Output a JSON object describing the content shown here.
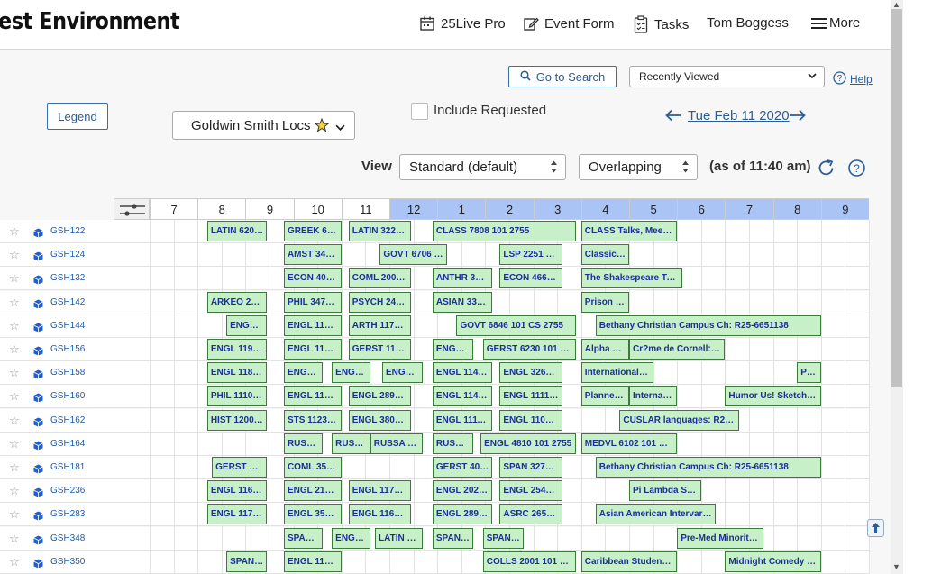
{
  "header": {
    "app_title": "est Environment",
    "nav": [
      {
        "label": "25Live Pro",
        "icon": "calendar-icon"
      },
      {
        "label": "Event Form",
        "icon": "edit-icon"
      },
      {
        "label": "Tasks",
        "icon": "clipboard-icon"
      },
      {
        "label": "Tom Boggess",
        "icon": ""
      },
      {
        "label": "More",
        "icon": "hamburger-icon"
      }
    ]
  },
  "toolbar": {
    "go_to_search": "Go to Search",
    "recently_viewed": "Recently Viewed",
    "help": "Help",
    "legend": "Legend",
    "locations_set": "Goldwin Smith Locs",
    "include_requested": "Include Requested",
    "date": "Tue Feb 11 2020",
    "view_label": "View",
    "view_value": "Standard (default)",
    "overlap_value": "Overlapping",
    "as_of": "(as of 11:40 am)"
  },
  "hours": [
    "7",
    "8",
    "9",
    "10",
    "11",
    "12",
    "1",
    "2",
    "3",
    "4",
    "5",
    "6",
    "7",
    "8",
    "9"
  ],
  "colors": {
    "accent": "#2a5d94",
    "pm_header": "#a9c4f5",
    "event_fill": "#c8f0c8",
    "event_border": "#3b7a3b",
    "event_text": "#1b2f9a"
  },
  "rooms": [
    {
      "name": "GSH122",
      "events": [
        {
          "label": "LATIN 6202 ...",
          "start": 8.2,
          "end": 9.45
        },
        {
          "label": "GREEK 6102...",
          "start": 9.8,
          "end": 11.0
        },
        {
          "label": "LATIN 3220 ...",
          "start": 11.15,
          "end": 12.45
        },
        {
          "label": "CLASS 7808 101 2755",
          "start": 12.9,
          "end": 15.9
        },
        {
          "label": "CLASS Talks, Meetings, Read: R2...",
          "start": 16.0,
          "end": 18.0
        }
      ]
    },
    {
      "name": "GSH124",
      "events": [
        {
          "label": "AMST 3434 ...",
          "start": 9.8,
          "end": 11.0
        },
        {
          "label": "GOVT 6706 101 CS 2...",
          "start": 11.8,
          "end": 13.2
        },
        {
          "label": "LSP 2251 10...",
          "start": 14.3,
          "end": 15.6
        },
        {
          "label": "Classics ...",
          "start": 16.0,
          "end": 17.0
        }
      ]
    },
    {
      "name": "GSH132",
      "events": [
        {
          "label": "ECON 4020 ...",
          "start": 9.8,
          "end": 11.0
        },
        {
          "label": "COML 2000 ...",
          "start": 11.15,
          "end": 12.45
        },
        {
          "label": "ANTHR 306...",
          "start": 12.9,
          "end": 14.15
        },
        {
          "label": "ECON 4660 ...",
          "start": 14.3,
          "end": 15.6
        },
        {
          "label": "The Shakespeare Troupe at C: R...",
          "start": 16.0,
          "end": 18.1
        }
      ]
    },
    {
      "name": "GSH142",
      "events": [
        {
          "label": "ARKEO 2661...",
          "start": 8.2,
          "end": 9.45
        },
        {
          "label": "PHIL 3475 0...",
          "start": 9.8,
          "end": 11.0
        },
        {
          "label": "PSYCH 2415...",
          "start": 11.15,
          "end": 12.45
        },
        {
          "label": "ASIAN 3304...",
          "start": 12.9,
          "end": 14.15
        },
        {
          "label": "Prison R...",
          "start": 16.0,
          "end": 17.0
        }
      ]
    },
    {
      "name": "GSH144",
      "events": [
        {
          "label": "ENGL 2...",
          "start": 8.6,
          "end": 9.45
        },
        {
          "label": "ENGL 1147 1...",
          "start": 9.8,
          "end": 11.0
        },
        {
          "label": "ARTH 1171 1...",
          "start": 11.15,
          "end": 12.45
        },
        {
          "label": "GOVT 6846 101 CS 2755",
          "start": 13.4,
          "end": 15.9
        },
        {
          "label": "Bethany Christian Campus Ch: R25-6651138",
          "start": 16.3,
          "end": 21.0
        }
      ]
    },
    {
      "name": "GSH156",
      "events": [
        {
          "label": "ENGL 1191 1...",
          "start": 8.2,
          "end": 9.45
        },
        {
          "label": "ENGL 1120 1...",
          "start": 9.8,
          "end": 11.0
        },
        {
          "label": "GERST 1170 ...",
          "start": 11.15,
          "end": 12.45
        },
        {
          "label": "ENGL 2...",
          "start": 12.9,
          "end": 13.75
        },
        {
          "label": "GERST 6230 101 2755",
          "start": 13.95,
          "end": 15.9
        },
        {
          "label": "Alpha Ph...",
          "start": 16.0,
          "end": 17.0
        },
        {
          "label": "Cr?me de Cornell: R2...",
          "start": 17.0,
          "end": 19.0
        }
      ]
    },
    {
      "name": "GSH158",
      "events": [
        {
          "label": "ENGL 1183 1...",
          "start": 8.2,
          "end": 9.45
        },
        {
          "label": "ENGL 2...",
          "start": 9.8,
          "end": 10.6
        },
        {
          "label": "ENGL 2...",
          "start": 10.8,
          "end": 11.6
        },
        {
          "label": "ENGL 2...",
          "start": 11.85,
          "end": 12.7
        },
        {
          "label": "ENGL 1147 1...",
          "start": 12.9,
          "end": 14.15
        },
        {
          "label": "ENGL 3260 ...",
          "start": 14.3,
          "end": 15.6
        },
        {
          "label": "International S...",
          "start": 16.0,
          "end": 17.5
        },
        {
          "label": "Pa...",
          "start": 20.5,
          "end": 21.0
        }
      ]
    },
    {
      "name": "GSH160",
      "events": [
        {
          "label": "PHIL 1110 10...",
          "start": 8.2,
          "end": 9.45
        },
        {
          "label": "ENGL 1167 1...",
          "start": 9.8,
          "end": 11.0
        },
        {
          "label": "ENGL 2890 ...",
          "start": 11.15,
          "end": 12.45
        },
        {
          "label": "ENGL 1147 1...",
          "start": 12.9,
          "end": 14.15
        },
        {
          "label": "ENGL 1111 1...",
          "start": 14.3,
          "end": 15.6
        },
        {
          "label": "Planned ...",
          "start": 16.0,
          "end": 17.0
        },
        {
          "label": "Internati...",
          "start": 17.0,
          "end": 18.0
        },
        {
          "label": "Humor Us! Sketch Co...",
          "start": 19.0,
          "end": 21.0
        }
      ]
    },
    {
      "name": "GSH162",
      "events": [
        {
          "label": "HIST 1200 1...",
          "start": 8.2,
          "end": 9.45
        },
        {
          "label": "STS 1123 10...",
          "start": 9.8,
          "end": 11.0
        },
        {
          "label": "ENGL 3805 ...",
          "start": 11.15,
          "end": 12.45
        },
        {
          "label": "ENGL 1111 1...",
          "start": 12.9,
          "end": 14.15
        },
        {
          "label": "ENGL 1105 1...",
          "start": 14.3,
          "end": 15.6
        },
        {
          "label": "CUSLAR languages: R25-6...",
          "start": 16.8,
          "end": 19.3
        }
      ]
    },
    {
      "name": "GSH164",
      "events": [
        {
          "label": "RUSSA ...",
          "start": 9.8,
          "end": 10.6
        },
        {
          "label": "RUSSA ...",
          "start": 10.8,
          "end": 11.6
        },
        {
          "label": "RUSSA 11...",
          "start": 11.6,
          "end": 12.7
        },
        {
          "label": "RUSSA ...",
          "start": 12.9,
          "end": 13.75
        },
        {
          "label": "ENGL 4810 101 2755",
          "start": 13.9,
          "end": 15.9
        },
        {
          "label": "MEDVL 6102 101 CS 2...",
          "start": 16.0,
          "end": 18.0
        }
      ]
    },
    {
      "name": "GSH181",
      "events": [
        {
          "label": "GERST Depa...",
          "start": 8.3,
          "end": 9.45
        },
        {
          "label": "COML 3512 ...",
          "start": 9.8,
          "end": 11.0
        },
        {
          "label": "GERST 400...",
          "start": 12.9,
          "end": 14.15
        },
        {
          "label": "SPAN 3270 ...",
          "start": 14.3,
          "end": 15.6
        },
        {
          "label": "Bethany Christian Campus Ch: R25-6651138",
          "start": 16.3,
          "end": 21.0
        }
      ]
    },
    {
      "name": "GSH236",
      "events": [
        {
          "label": "ENGL 1168 1...",
          "start": 8.2,
          "end": 9.45
        },
        {
          "label": "ENGL 2100 ...",
          "start": 9.8,
          "end": 11.0
        },
        {
          "label": "ENGL 1170 1...",
          "start": 11.15,
          "end": 12.45
        },
        {
          "label": "ENGL 2020 ...",
          "start": 12.9,
          "end": 14.15
        },
        {
          "label": "ENGL 2545 ...",
          "start": 14.3,
          "end": 15.6
        },
        {
          "label": "Pi Lambda Sig...",
          "start": 17.0,
          "end": 18.5
        }
      ]
    },
    {
      "name": "GSH283",
      "events": [
        {
          "label": "ENGL 1170 1...",
          "start": 8.2,
          "end": 9.45
        },
        {
          "label": "ENGL 3530 ...",
          "start": 9.8,
          "end": 11.0
        },
        {
          "label": "ENGL 1168 1...",
          "start": 11.15,
          "end": 12.45
        },
        {
          "label": "ENGL 2890 ...",
          "start": 12.9,
          "end": 14.15
        },
        {
          "label": "ASRC 2650 ...",
          "start": 14.3,
          "end": 15.6
        },
        {
          "label": "Asian American Intervarsit...",
          "start": 16.3,
          "end": 18.8
        }
      ]
    },
    {
      "name": "GSH348",
      "events": [
        {
          "label": "SPAN 1...",
          "start": 9.8,
          "end": 10.6
        },
        {
          "label": "ENGL 2...",
          "start": 10.8,
          "end": 11.6
        },
        {
          "label": "LATIN 72...",
          "start": 11.7,
          "end": 12.7
        },
        {
          "label": "SPAN 1...",
          "start": 12.9,
          "end": 13.75
        },
        {
          "label": "SPAN 1...",
          "start": 13.95,
          "end": 14.8
        },
        {
          "label": "Pre-Med Minoritie...",
          "start": 18.0,
          "end": 19.8
        }
      ]
    },
    {
      "name": "GSH350",
      "events": [
        {
          "label": "SPAN 1...",
          "start": 8.6,
          "end": 9.45
        },
        {
          "label": "ENGL 1168 1...",
          "start": 9.8,
          "end": 11.0
        },
        {
          "label": "COLLS 2001 101 2755",
          "start": 13.95,
          "end": 15.9
        },
        {
          "label": "Caribbean Students'...",
          "start": 16.0,
          "end": 18.0
        },
        {
          "label": "Midnight Comedy Mt...",
          "start": 19.0,
          "end": 21.0
        }
      ]
    }
  ]
}
